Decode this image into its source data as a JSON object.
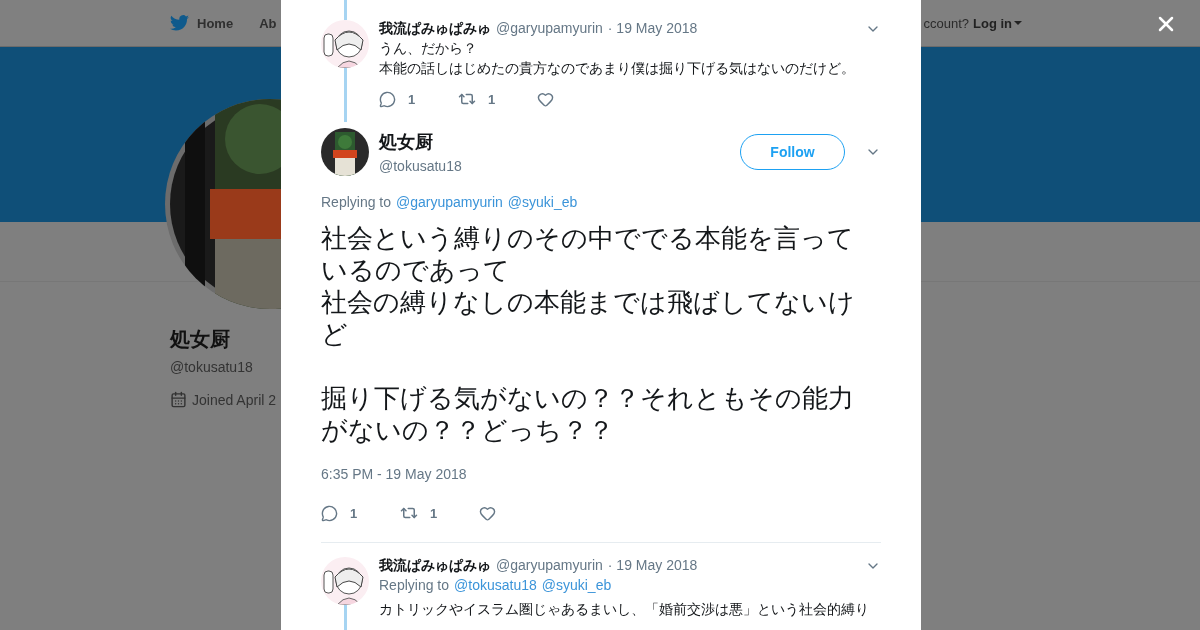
{
  "top_nav": {
    "items": [
      {
        "label": "Home"
      },
      {
        "label": "Ab"
      }
    ],
    "account_prompt": "ccount?",
    "login": "Log in"
  },
  "profile": {
    "name": "処女厨",
    "handle": "@tokusatu18",
    "joined": "Joined April 2"
  },
  "modal": {
    "tweets": [
      {
        "kind": "reply",
        "name": "我流ぱみゅぱみゅ",
        "handle": "@garyupamyurin",
        "date": "· 19 May 2018",
        "lines": [
          "うん、だから？",
          "本能の話しはじめたの貴方なのであまり僕は掘り下げる気はないのだけど。"
        ],
        "replies": "1",
        "retweets": "1"
      },
      {
        "kind": "focused",
        "name": "処女厨",
        "handle": "@tokusatu18",
        "follow": "Follow",
        "replying_to": "Replying to",
        "mentions": [
          "@garyupamyurin",
          "@syuki_eb"
        ],
        "paragraphs": [
          "社会という縛りのその中ででる本能を言っているのであって",
          "社会の縛りなしの本能までは飛ばしてないけど",
          "掘り下げる気がないの？？それともその能力がないの？？どっち？？"
        ],
        "time": "6:35 PM - 19 May 2018",
        "replies": "1",
        "retweets": "1"
      },
      {
        "kind": "reply",
        "name": "我流ぱみゅぱみゅ",
        "handle": "@garyupamyurin",
        "date": "· 19 May 2018",
        "replying_to": "Replying to",
        "mentions": [
          "@tokusatu18",
          "@syuki_eb"
        ],
        "lines": [
          "カトリックやイスラム圏じゃあるまいし、「婚前交渉は悪」という社会的縛り"
        ]
      }
    ]
  }
}
